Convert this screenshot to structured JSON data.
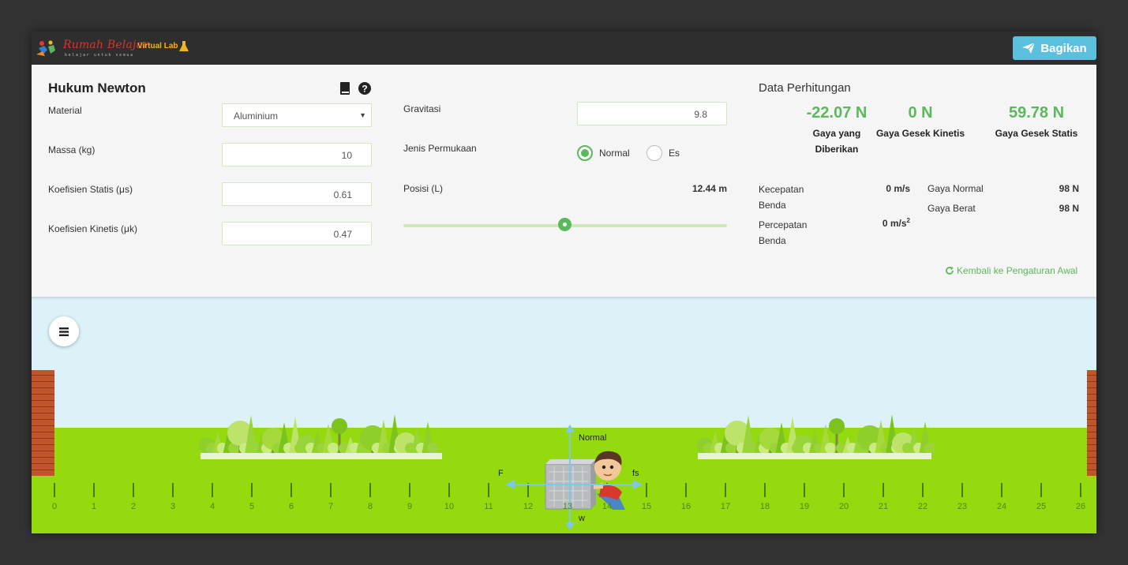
{
  "header": {
    "brand_name": "Rumah Belajar",
    "brand_tagline": "belajar untuk semua",
    "brand_sub": "Virtual Lab",
    "share_label": "Bagikan"
  },
  "panel": {
    "title": "Hukum Newton",
    "material": {
      "label": "Material",
      "value": "Aluminium"
    },
    "mass": {
      "label": "Massa (kg)",
      "value": "10"
    },
    "static_coef": {
      "label": "Koefisien Statis (μs)",
      "value": "0.61"
    },
    "kinetic_coef": {
      "label": "Koefisien Kinetis (μk)",
      "value": "0.47"
    },
    "gravity": {
      "label": "Gravitasi",
      "value": "9.8"
    },
    "surface": {
      "label": "Jenis Permukaan",
      "options": [
        "Normal",
        "Es"
      ],
      "selected": "Normal"
    },
    "position": {
      "label": "Posisi (L)",
      "value": "12.44 m",
      "slider_fraction": 0.497
    }
  },
  "results": {
    "title": "Data Perhitungan",
    "applied_force": {
      "value": "-22.07 N",
      "label": "Gaya yang Diberikan"
    },
    "kinetic_friction": {
      "value": "0 N",
      "label": "Gaya Gesek Kinetis"
    },
    "static_friction": {
      "value": "59.78 N",
      "label": "Gaya Gesek Statis"
    },
    "velocity": {
      "label": "Kecepatan Benda",
      "value": "0 m/s"
    },
    "acceleration": {
      "label": "Percepatan Benda",
      "value": "0 m/s",
      "unit_exp": "2"
    },
    "normal_force": {
      "label": "Gaya Normal",
      "value": "98 N"
    },
    "weight": {
      "label": "Gaya Berat",
      "value": "98 N"
    },
    "reset_label": "Kembali ke Pengaturan Awal"
  },
  "scene": {
    "force_labels": {
      "normal": "Normal",
      "applied": "F",
      "friction": "fs",
      "weight": "w"
    },
    "ruler": {
      "min": 0,
      "max": 26,
      "labels": [
        "0",
        "1",
        "2",
        "3",
        "4",
        "5",
        "6",
        "7",
        "8",
        "9",
        "10",
        "11",
        "12",
        "13",
        "14",
        "15",
        "16",
        "17",
        "18",
        "19",
        "20",
        "21",
        "22",
        "23",
        "24",
        "25",
        "26"
      ]
    }
  },
  "colors": {
    "accent": "#5cb85c",
    "share": "#5bc0de",
    "ground": "#95d90f",
    "sky": "#dcf1f8",
    "brick": "#c1542a"
  }
}
